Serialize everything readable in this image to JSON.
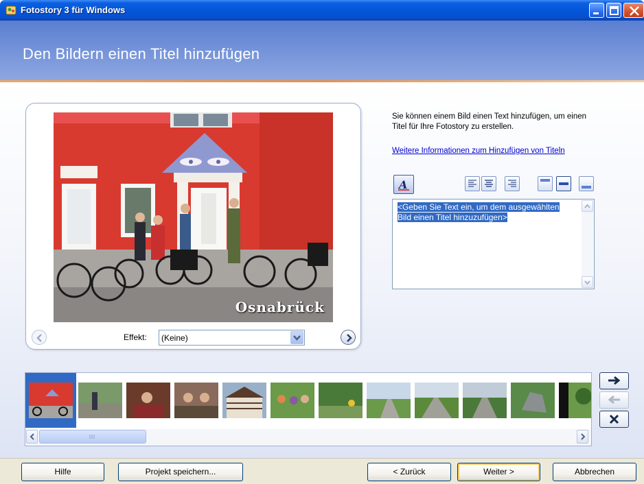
{
  "window": {
    "title": "Fotostory 3 für Windows",
    "accent": "#0454d8"
  },
  "header": {
    "heading": "Den Bildern einen Titel hinzufügen"
  },
  "preview": {
    "photo_caption": "Osnabrück",
    "effect_label": "Effekt:",
    "effect_value": "(Keine)"
  },
  "info": {
    "description": "Sie können einem Bild einen Text hinzufügen, um einen Titel für Ihre Fotostory zu erstellen.",
    "link": "Weitere Informationen zum Hinzufügen von Titeln"
  },
  "title_editor": {
    "placeholder": "<Geben Sie Text ein, um dem ausgewählten Bild einen Titel hinzuzufügen>",
    "tools": [
      "font-icon",
      "align-left-icon",
      "align-center-icon",
      "align-right-icon",
      "align-top-icon",
      "align-middle-icon",
      "align-bottom-icon"
    ]
  },
  "filmstrip": {
    "thumbnail_count": 12,
    "selected_index": 0,
    "side_buttons": [
      "move-right-icon",
      "move-left-icon",
      "delete-icon"
    ]
  },
  "footer": {
    "help": "Hilfe",
    "save_project": "Projekt speichern...",
    "back": "< Zurück",
    "next": "Weiter >",
    "cancel": "Abbrechen"
  }
}
